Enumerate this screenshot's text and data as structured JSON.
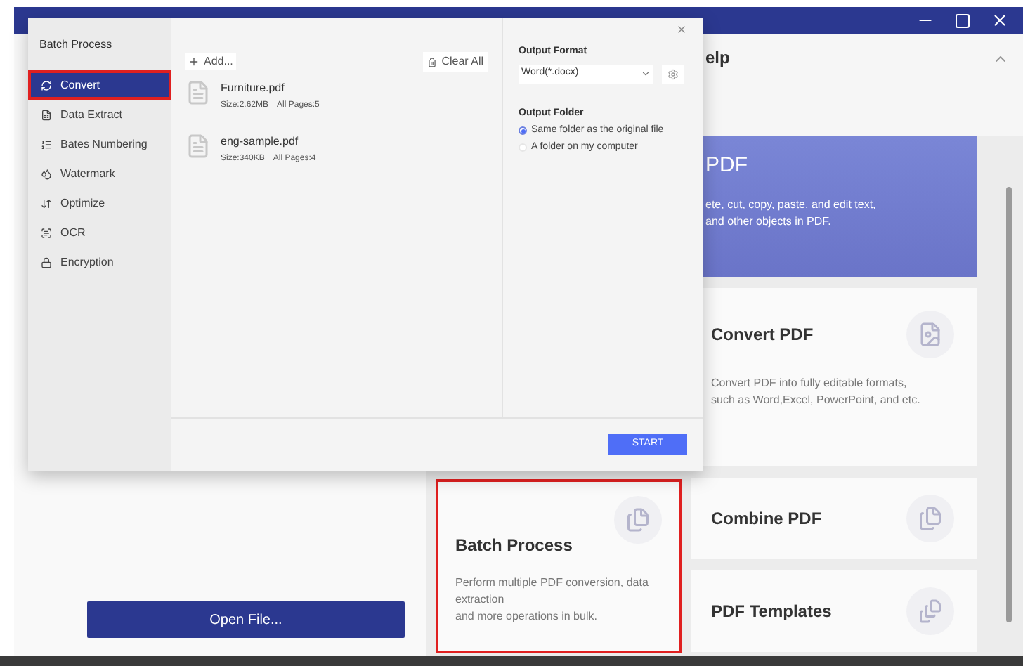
{
  "header": {
    "title_fragment": "elp"
  },
  "left_panel": {
    "open_button": "Open File..."
  },
  "featured_card": {
    "title": "PDF",
    "lines": [
      "ete, cut, copy, paste, and edit text,",
      "and other objects in PDF."
    ]
  },
  "left_cards": [
    {
      "title": "Batch Process",
      "lines": [
        "Perform multiple PDF conversion, data",
        "extraction",
        "and more operations in bulk."
      ],
      "highlighted": true
    }
  ],
  "right_cards": [
    {
      "title": "Convert PDF",
      "lines": [
        "Convert PDF into fully editable formats,",
        "such as Word,Excel, PowerPoint, and etc."
      ],
      "highlighted": false
    },
    {
      "title": "Combine PDF",
      "highlighted": false
    },
    {
      "title": "PDF Templates",
      "highlighted": false
    }
  ],
  "dialog": {
    "title": "Batch Process",
    "menu": [
      {
        "kind": "convert",
        "label": "Convert",
        "selected": true,
        "highlighted": true
      },
      {
        "kind": "extract",
        "label": "Data Extract",
        "selected": false,
        "highlighted": false
      },
      {
        "kind": "bates",
        "label": "Bates Numbering",
        "selected": false,
        "highlighted": false
      },
      {
        "kind": "watermark",
        "label": "Watermark",
        "selected": false,
        "highlighted": false
      },
      {
        "kind": "optimize",
        "label": "Optimize",
        "selected": false,
        "highlighted": false
      },
      {
        "kind": "ocr",
        "label": "OCR",
        "selected": false,
        "highlighted": false
      },
      {
        "kind": "encryption",
        "label": "Encryption",
        "selected": false,
        "highlighted": false
      }
    ],
    "add_label": "Add...",
    "clear_label": "Clear All",
    "files": [
      {
        "name": "Furniture.pdf",
        "size": "Size:2.62MB",
        "pages": "All Pages:5"
      },
      {
        "name": "eng-sample.pdf",
        "size": "Size:340KB",
        "pages": "All Pages:4"
      }
    ],
    "output_format": {
      "label": "Output Format",
      "value": "Word(*.docx)"
    },
    "output_folder": {
      "label": "Output Folder",
      "options": [
        {
          "label": "Same folder as the original file",
          "selected": true
        },
        {
          "label": "A folder on my computer",
          "selected": false
        }
      ]
    },
    "start": "START"
  }
}
